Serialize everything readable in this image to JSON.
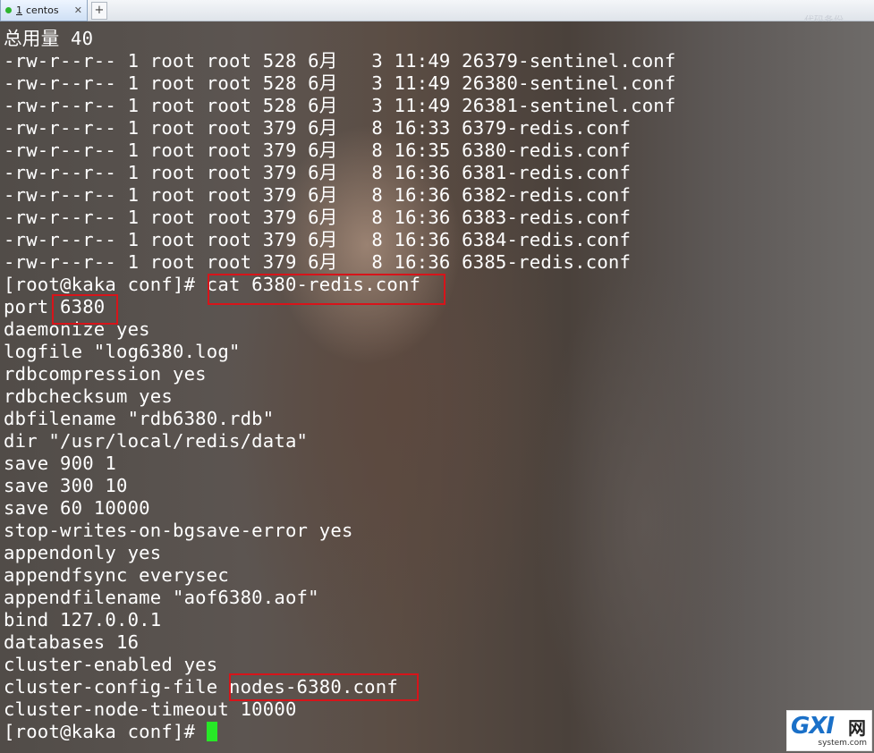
{
  "tabbar": {
    "tab": {
      "number": "1",
      "title": "centos",
      "close_label": "✕"
    },
    "add_label": "+",
    "hint": "代码备份"
  },
  "terminal": {
    "lines": [
      "总用量 40",
      "-rw-r--r-- 1 root root 528 6月   3 11:49 26379-sentinel.conf",
      "-rw-r--r-- 1 root root 528 6月   3 11:49 26380-sentinel.conf",
      "-rw-r--r-- 1 root root 528 6月   3 11:49 26381-sentinel.conf",
      "-rw-r--r-- 1 root root 379 6月   8 16:33 6379-redis.conf",
      "-rw-r--r-- 1 root root 379 6月   8 16:35 6380-redis.conf",
      "-rw-r--r-- 1 root root 379 6月   8 16:36 6381-redis.conf",
      "-rw-r--r-- 1 root root 379 6月   8 16:36 6382-redis.conf",
      "-rw-r--r-- 1 root root 379 6月   8 16:36 6383-redis.conf",
      "-rw-r--r-- 1 root root 379 6月   8 16:36 6384-redis.conf",
      "-rw-r--r-- 1 root root 379 6月   8 16:36 6385-redis.conf",
      "[root@kaka conf]# cat 6380-redis.conf",
      "port 6380",
      "daemonize yes",
      "logfile \"log6380.log\"",
      "rdbcompression yes",
      "rdbchecksum yes",
      "dbfilename \"rdb6380.rdb\"",
      "dir \"/usr/local/redis/data\"",
      "save 900 1",
      "save 300 10",
      "save 60 10000",
      "stop-writes-on-bgsave-error yes",
      "appendonly yes",
      "appendfsync everysec",
      "appendfilename \"aof6380.aof\"",
      "bind 127.0.0.1",
      "databases 16",
      "cluster-enabled yes",
      "cluster-config-file nodes-6380.conf",
      "cluster-node-timeout 10000"
    ],
    "prompt": "[root@kaka conf]# ",
    "colors": {
      "text": "#ffffff",
      "highlight_box": "#d7141a",
      "cursor": "#27e827"
    }
  },
  "watermark": {
    "logo": "GXI",
    "cn": "网",
    "site": "system.com"
  }
}
